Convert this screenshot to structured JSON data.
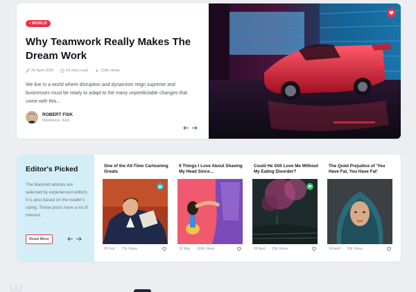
{
  "hero": {
    "tag": "• WORLD",
    "title": "Why Teamwork Really Makes The Dream Work",
    "date": "25 April 2020",
    "read_time": "10 mins read",
    "views": "159k Views",
    "excerpt": "We live in a world where disruption and dynamism reign supreme and businesses must be ready to adapt to the many unpredictable changes that come with this...",
    "author_name": "ROBERT FISK",
    "author_location": "Maidstone, Kent",
    "prev_arrow": "←",
    "next_arrow": "→"
  },
  "picks": {
    "title": "Editor's Picked",
    "description": "The featured articles are selected by experienced editors. It is also based on the reader's rating. These posts have a lot of interest.",
    "read_more": "Read More",
    "cards": [
      {
        "title": "One of the All-Time Cartooning Greats",
        "date": "26 Feb",
        "views": "72k Views",
        "badge_icon": "camera-icon"
      },
      {
        "title": "9 Things I Love About Shaving My Head Since...",
        "date": "16 May",
        "views": "169k Views",
        "badge_icon": ""
      },
      {
        "title": "Could He Still Love Me Without My Eating Disorder?",
        "date": "05 April",
        "views": "35k Views",
        "badge_icon": "chat-icon"
      },
      {
        "title": "The Quiet Prejudice of 'You Have Fat, You Have Fat'",
        "date": "14 April",
        "views": "30k Views",
        "badge_icon": ""
      }
    ]
  },
  "colors": {
    "accent": "#e8334a",
    "panel": "#d3eef6",
    "badge_teal": "#2bb3c0",
    "badge_green": "#31c46a"
  }
}
